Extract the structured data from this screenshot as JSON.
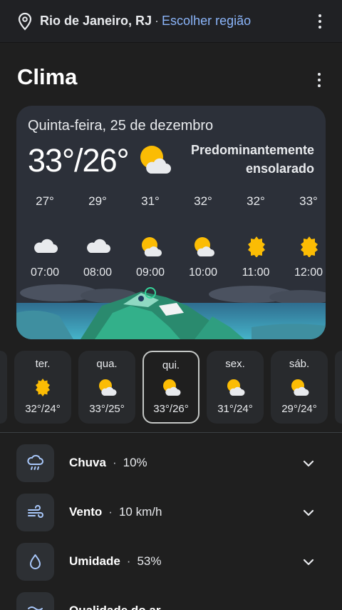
{
  "topbar": {
    "location": "Rio de Janeiro, RJ",
    "separator": "·",
    "region_link": "Escolher região"
  },
  "page_title": "Clima",
  "today": {
    "date": "Quinta-feira, 25 de dezembro",
    "temp": "33°/26°",
    "condition_line1": "Predominantemente",
    "condition_line2": "ensolarado",
    "condition_icon": "partly-sunny-icon"
  },
  "hourly": [
    {
      "temp": "27°",
      "icon": "cloudy-icon",
      "time": "07:00"
    },
    {
      "temp": "29°",
      "icon": "cloudy-icon",
      "time": "08:00"
    },
    {
      "temp": "31°",
      "icon": "partly-sunny-icon",
      "time": "09:00"
    },
    {
      "temp": "32°",
      "icon": "partly-sunny-icon",
      "time": "10:00"
    },
    {
      "temp": "32°",
      "icon": "sunny-icon",
      "time": "11:00"
    },
    {
      "temp": "33°",
      "icon": "sunny-icon",
      "time": "12:00"
    }
  ],
  "days": [
    {
      "name": "ter.",
      "icon": "sunny-icon",
      "temps": "32°/24°"
    },
    {
      "name": "qua.",
      "icon": "partly-sunny-icon",
      "temps": "33°/25°"
    },
    {
      "name": "qui.",
      "icon": "partly-sunny-icon",
      "temps": "33°/26°",
      "selected": true
    },
    {
      "name": "sex.",
      "icon": "partly-sunny-icon",
      "temps": "31°/24°"
    },
    {
      "name": "sáb.",
      "icon": "partly-sunny-icon",
      "temps": "29°/24°"
    }
  ],
  "details": [
    {
      "label": "Chuva",
      "sep": "·",
      "value": "10%",
      "icon": "rain-icon"
    },
    {
      "label": "Vento",
      "sep": "·",
      "value": "10 km/h",
      "icon": "wind-icon"
    },
    {
      "label": "Umidade",
      "sep": "·",
      "value": "53%",
      "icon": "droplet-icon"
    },
    {
      "label": "Qualidade do ar",
      "sep": "",
      "value": "",
      "icon": "air-quality-icon"
    }
  ],
  "colors": {
    "background": "#1f1f1f",
    "card": "#2c3039",
    "link": "#8ab4f8",
    "sun": "#fbbc04",
    "detail_icon": "#a8c7fa"
  }
}
